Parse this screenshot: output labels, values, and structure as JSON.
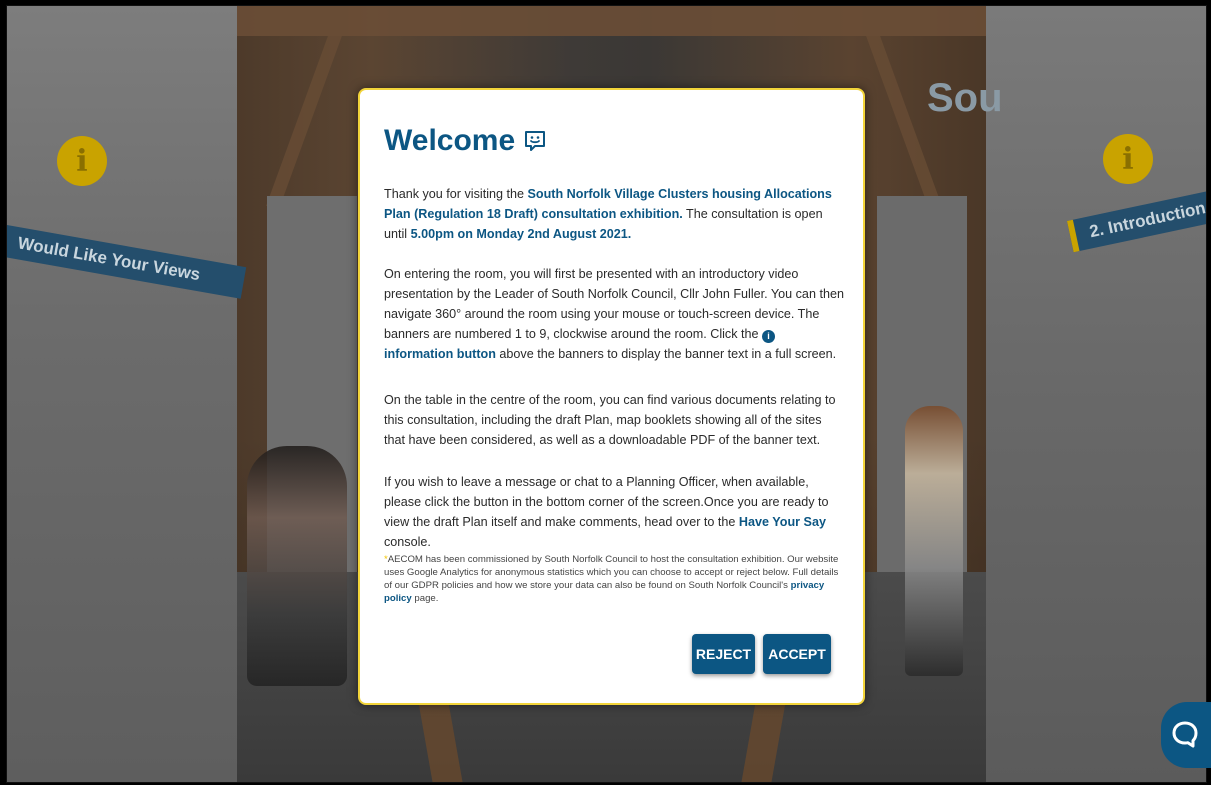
{
  "scene": {
    "left_banner": "Would Like Your Views",
    "right_banner": "2. Introduction",
    "logo_partial": "Sou",
    "info_symbol": "i"
  },
  "modal": {
    "title": "Welcome",
    "p1_a": "Thank you for visiting the ",
    "p1_b": "South Norfolk Village Clusters housing Allocations Plan (Regulation 18 Draft) consultation exhibition.",
    "p1_c": " The consultation is open until ",
    "p1_d": "5.00pm on Monday 2nd August 2021.",
    "p2_a": "On entering the room, you will first be presented with an introductory video presentation by the Leader of South Norfolk Council, Cllr John Fuller. You can then navigate 360° around the room using your mouse or touch-screen device. The banners are numbered 1 to 9, clockwise around the room. Click the ",
    "p2_b": "information button",
    "p2_c": " above the banners to display the banner text in a full screen.",
    "p3": "On the table in the centre of the room, you can find various documents relating to this consultation, including the draft Plan, map booklets showing all of the sites that have been considered, as well as a downloadable PDF of the banner text.",
    "p4_a": "If you wish to leave a message or chat to a Planning Officer, when available, please click the button in the bottom corner of the screen.Once you are ready to view the draft Plan itself and make comments, head over to the ",
    "p4_b": "Have Your Say",
    "p4_c": " console.",
    "note_star": "*",
    "note_a": "AECOM has been commissioned by South Norfolk Council to host the consultation exhibition. Our website uses Google Analytics for anonymous statistics which you can choose to accept or reject below. Full details of our GDPR policies and how we store your data can also be found on South Norfolk Council's ",
    "note_link": "privacy policy",
    "note_b": " page.",
    "reject_label": "REJECT",
    "accept_label": "ACCEPT"
  },
  "colors": {
    "brand_blue": "#0c5683",
    "accent_yellow": "#f2d43a"
  }
}
